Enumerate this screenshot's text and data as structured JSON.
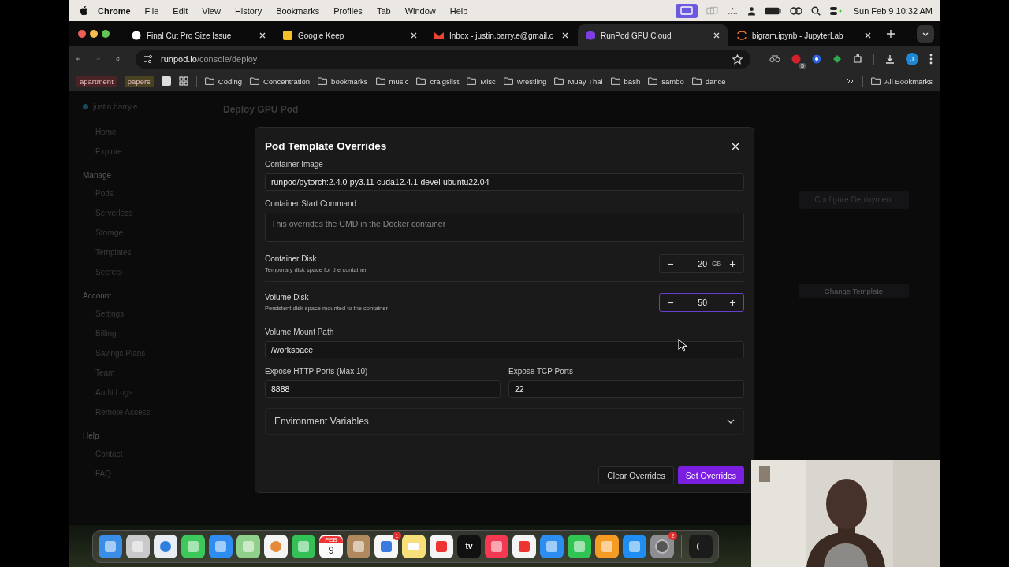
{
  "menu_bar": {
    "app": "Chrome",
    "menus": [
      "File",
      "Edit",
      "View",
      "History",
      "Bookmarks",
      "Profiles",
      "Tab",
      "Window",
      "Help"
    ],
    "clock": "Sun Feb 9  10:32 AM"
  },
  "tabs": [
    {
      "title": "Final Cut Pro Size Issue",
      "kind": "chat",
      "selected": false
    },
    {
      "title": "Google Keep",
      "kind": "keep",
      "selected": false
    },
    {
      "title": "Inbox - justin.barry.e@gmail.c",
      "kind": "mail",
      "selected": false
    },
    {
      "title": "RunPod GPU Cloud",
      "kind": "runpod",
      "selected": true
    },
    {
      "title": "bigram.ipynb - JupyterLab",
      "kind": "jupyter",
      "selected": false
    }
  ],
  "address_bar": {
    "host": "runpod.io",
    "path": "/console/deploy"
  },
  "extension_badge": "5",
  "profile_initial": "J",
  "bookmarks": [
    {
      "label": "apartment",
      "kind": "tag",
      "color": "#4a2326"
    },
    {
      "label": "papers",
      "kind": "tag",
      "color": "#4a4322"
    },
    {
      "label": "Coding",
      "kind": "folder"
    },
    {
      "label": "Concentration",
      "kind": "folder"
    },
    {
      "label": "bookmarks",
      "kind": "folder"
    },
    {
      "label": "music",
      "kind": "folder"
    },
    {
      "label": "craigslist",
      "kind": "folder"
    },
    {
      "label": "Misc",
      "kind": "folder"
    },
    {
      "label": "wrestling",
      "kind": "folder"
    },
    {
      "label": "Muay Thai",
      "kind": "folder"
    },
    {
      "label": "bash",
      "kind": "folder"
    },
    {
      "label": "sambo",
      "kind": "folder"
    },
    {
      "label": "dance",
      "kind": "folder"
    }
  ],
  "all_bookmarks": "All Bookmarks",
  "sidebar": {
    "account": "justin.barry.e",
    "items": [
      {
        "label": "Home",
        "kind": "item"
      },
      {
        "label": "Explore",
        "kind": "item"
      },
      {
        "label": "Manage",
        "kind": "heading"
      },
      {
        "label": "Pods",
        "kind": "item"
      },
      {
        "label": "Serverless",
        "kind": "item"
      },
      {
        "label": "Storage",
        "kind": "item"
      },
      {
        "label": "Templates",
        "kind": "item"
      },
      {
        "label": "Secrets",
        "kind": "item"
      },
      {
        "label": "Account",
        "kind": "heading"
      },
      {
        "label": "Settings",
        "kind": "item"
      },
      {
        "label": "Billing",
        "kind": "item"
      },
      {
        "label": "Savings Plans",
        "kind": "item"
      },
      {
        "label": "Team",
        "kind": "item"
      },
      {
        "label": "Audit Logs",
        "kind": "item"
      },
      {
        "label": "Remote Access",
        "kind": "item"
      },
      {
        "label": "Help",
        "kind": "heading"
      },
      {
        "label": "Contact",
        "kind": "item"
      },
      {
        "label": "FAQ",
        "kind": "item"
      }
    ]
  },
  "page": {
    "title": "Deploy GPU Pod",
    "configure_button": "Configure Deployment",
    "change_template_button": "Change Template"
  },
  "modal": {
    "title": "Pod Template Overrides",
    "image": {
      "label": "Container Image",
      "value": "runpod/pytorch:2.4.0-py3.11-cuda12.4.1-devel-ubuntu22.04"
    },
    "start_command": {
      "label": "Container Start Command",
      "placeholder": "This overrides the CMD in the Docker container"
    },
    "disks": [
      {
        "label": "Container Disk",
        "hint": "Temporary disk space for the container",
        "value": "20",
        "unit": "GB",
        "focused": false
      },
      {
        "label": "Volume Disk",
        "hint": "Persistent disk space mounted to the container",
        "value": "50",
        "focused": true
      }
    ],
    "mount_path": {
      "label": "Volume Mount Path",
      "value": "/workspace"
    },
    "http_ports": {
      "label": "Expose HTTP Ports (Max 10)",
      "value": "8888"
    },
    "tcp_ports": {
      "label": "Expose TCP Ports",
      "value": "22"
    },
    "env": {
      "label": "Environment Variables",
      "expanded": false
    },
    "clear_button": "Clear Overrides",
    "set_button": "Set Overrides"
  },
  "dock": [
    {
      "kind": "finder"
    },
    {
      "kind": "launchpad"
    },
    {
      "kind": "safari"
    },
    {
      "kind": "messages"
    },
    {
      "kind": "mail"
    },
    {
      "kind": "maps"
    },
    {
      "kind": "photos"
    },
    {
      "kind": "facetime"
    },
    {
      "kind": "calendar",
      "month": "FEB",
      "day": "9"
    },
    {
      "kind": "contacts"
    },
    {
      "kind": "reminders",
      "badge": "1"
    },
    {
      "kind": "notes"
    },
    {
      "kind": "freeform"
    },
    {
      "kind": "tv",
      "label": "tv"
    },
    {
      "kind": "music"
    },
    {
      "kind": "news"
    },
    {
      "kind": "keynote"
    },
    {
      "kind": "numbers"
    },
    {
      "kind": "pages"
    },
    {
      "kind": "appstore"
    },
    {
      "kind": "settings",
      "badge": "2"
    },
    {
      "kind": "divider"
    },
    {
      "kind": "terminal"
    }
  ]
}
